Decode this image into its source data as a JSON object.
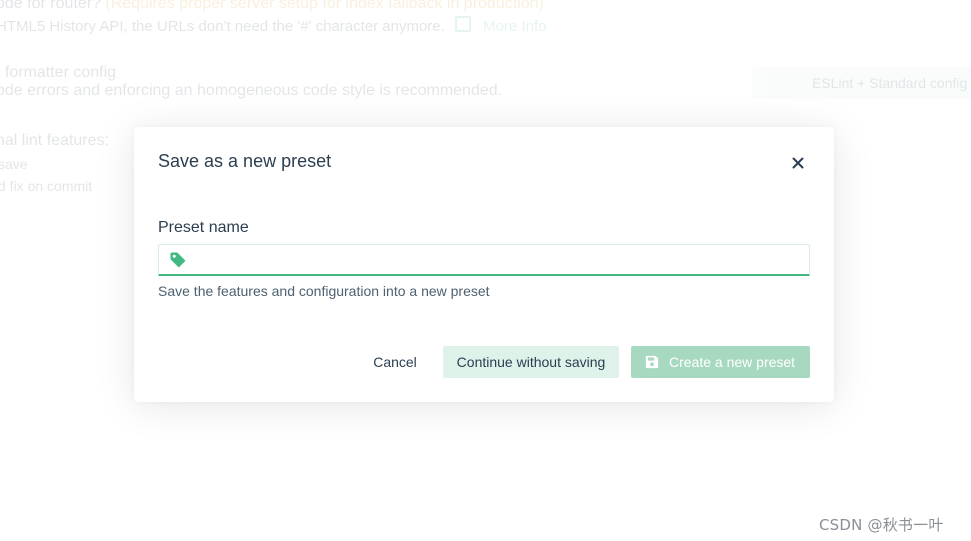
{
  "background": {
    "router_question": "ode for router?",
    "router_hint": "(Requires proper server setup for index fallback in production)",
    "router_desc": "HTML5 History API, the URLs don't need the '#' character anymore.",
    "more_info": "More Info",
    "linter_title": "/ formatter config",
    "linter_desc": "ode errors and enforcing an homogeneous code style is recommended.",
    "linter_value": "ESLint + Standard config",
    "lint_features_title": "nal lint features:",
    "lint_on_save": "save",
    "lint_fix_commit": "d fix on commit"
  },
  "dialog": {
    "title": "Save as a new preset",
    "field_label": "Preset name",
    "input_value": "",
    "input_placeholder": "",
    "field_description": "Save the features and configuration into a new preset",
    "cancel_label": "Cancel",
    "continue_label": "Continue without saving",
    "create_label": "Create a new preset"
  },
  "icons": {
    "close": "close-icon",
    "tag": "tag-icon",
    "save": "save-icon",
    "external_link": "external-link-icon"
  },
  "colors": {
    "accent": "#42b983",
    "text": "#2c3e50",
    "hint": "#d48a00",
    "secondary_button_bg": "#dff2ea",
    "primary_button_disabled_bg": "#a7d9c0"
  },
  "watermark": "CSDN @秋书一叶"
}
